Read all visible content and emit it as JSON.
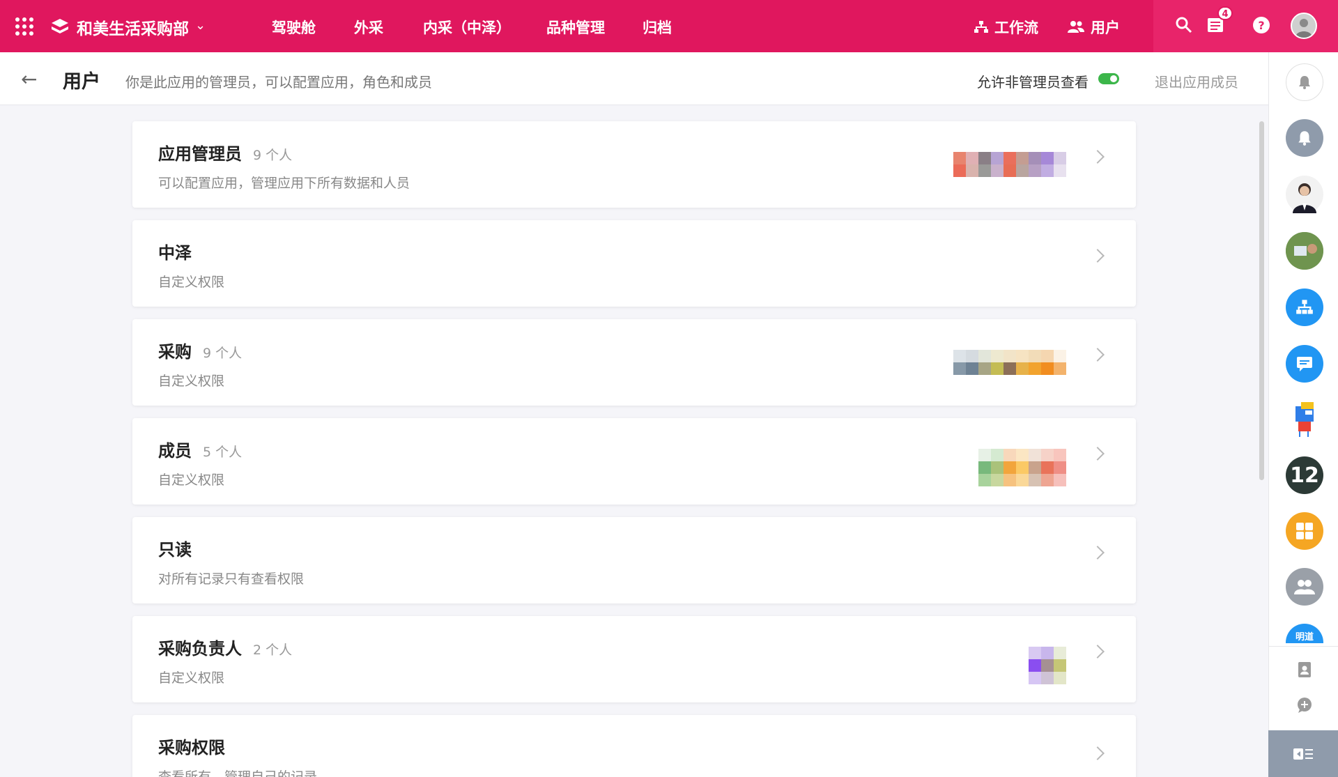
{
  "app": {
    "name": "和美生活采购部"
  },
  "nav": {
    "items": [
      {
        "label": "驾驶舱"
      },
      {
        "label": "外采"
      },
      {
        "label": "内采（中泽）"
      },
      {
        "label": "品种管理"
      },
      {
        "label": "归档"
      }
    ],
    "workflow_label": "工作流",
    "users_label": "用户",
    "notification_count": "4"
  },
  "subheader": {
    "title": "用户",
    "description": "你是此应用的管理员，可以配置应用，角色和成员",
    "toggle_label": "允许非管理员查看",
    "toggle_on": true,
    "exit_label": "退出应用成员"
  },
  "roles": [
    {
      "title": "应用管理员",
      "count": "9 个人",
      "desc": "可以配置应用，管理应用下所有数据和人员"
    },
    {
      "title": "中泽",
      "count": "",
      "desc": "自定义权限"
    },
    {
      "title": "采购",
      "count": "9 个人",
      "desc": "自定义权限"
    },
    {
      "title": "成员",
      "count": "5 个人",
      "desc": "自定义权限"
    },
    {
      "title": "只读",
      "count": "",
      "desc": "对所有记录只有查看权限"
    },
    {
      "title": "采购负责人",
      "count": "2 个人",
      "desc": "自定义权限"
    },
    {
      "title": "采购权限",
      "count": "",
      "desc": "查看所有，管理自己的记录"
    }
  ],
  "sidebar": {
    "mingdao_label": "明道",
    "number_label": "12"
  },
  "colors": {
    "brand": "#e0175e",
    "toggle_green": "#3cb64a",
    "sidebar_blue": "#2196f3",
    "sidebar_orange": "#f5a623"
  }
}
